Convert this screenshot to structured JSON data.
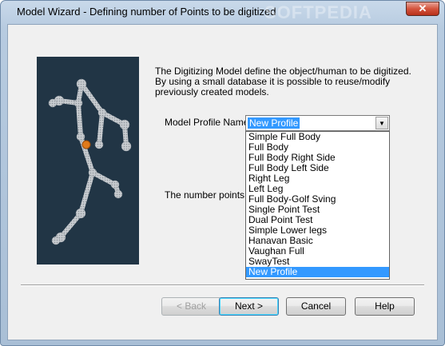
{
  "window": {
    "title": "Model Wizard - Defining number of Points to be digitized",
    "watermark": "SOFTPEDIA",
    "close_glyph": "✕"
  },
  "description": "The Digitizing Model define the object/human to be digitized. By using a small database it is possible to reuse/modify previously created models.",
  "profile": {
    "label": "Model Profile Name",
    "value": "New Profile",
    "dropdown_arrow": "▼",
    "options": [
      "Simple Full Body",
      "Full Body",
      "Full Body Right Side",
      "Full Body Left Side",
      "Right Leg",
      "Left Leg",
      "Full Body-Golf Sving",
      "Single Point Test",
      "Dual Point Test",
      "Simple Lower legs",
      "Hanavan Basic",
      "Vaughan Full",
      "SwayTest",
      "New Profile"
    ],
    "selected_index": 13
  },
  "points_label": "The number points to",
  "buttons": {
    "back": "< Back",
    "next": "Next >",
    "cancel": "Cancel",
    "help": "Help"
  },
  "colors": {
    "panel_bg": "#213545",
    "selection": "#3399ff",
    "marker": "#e07a1a"
  }
}
